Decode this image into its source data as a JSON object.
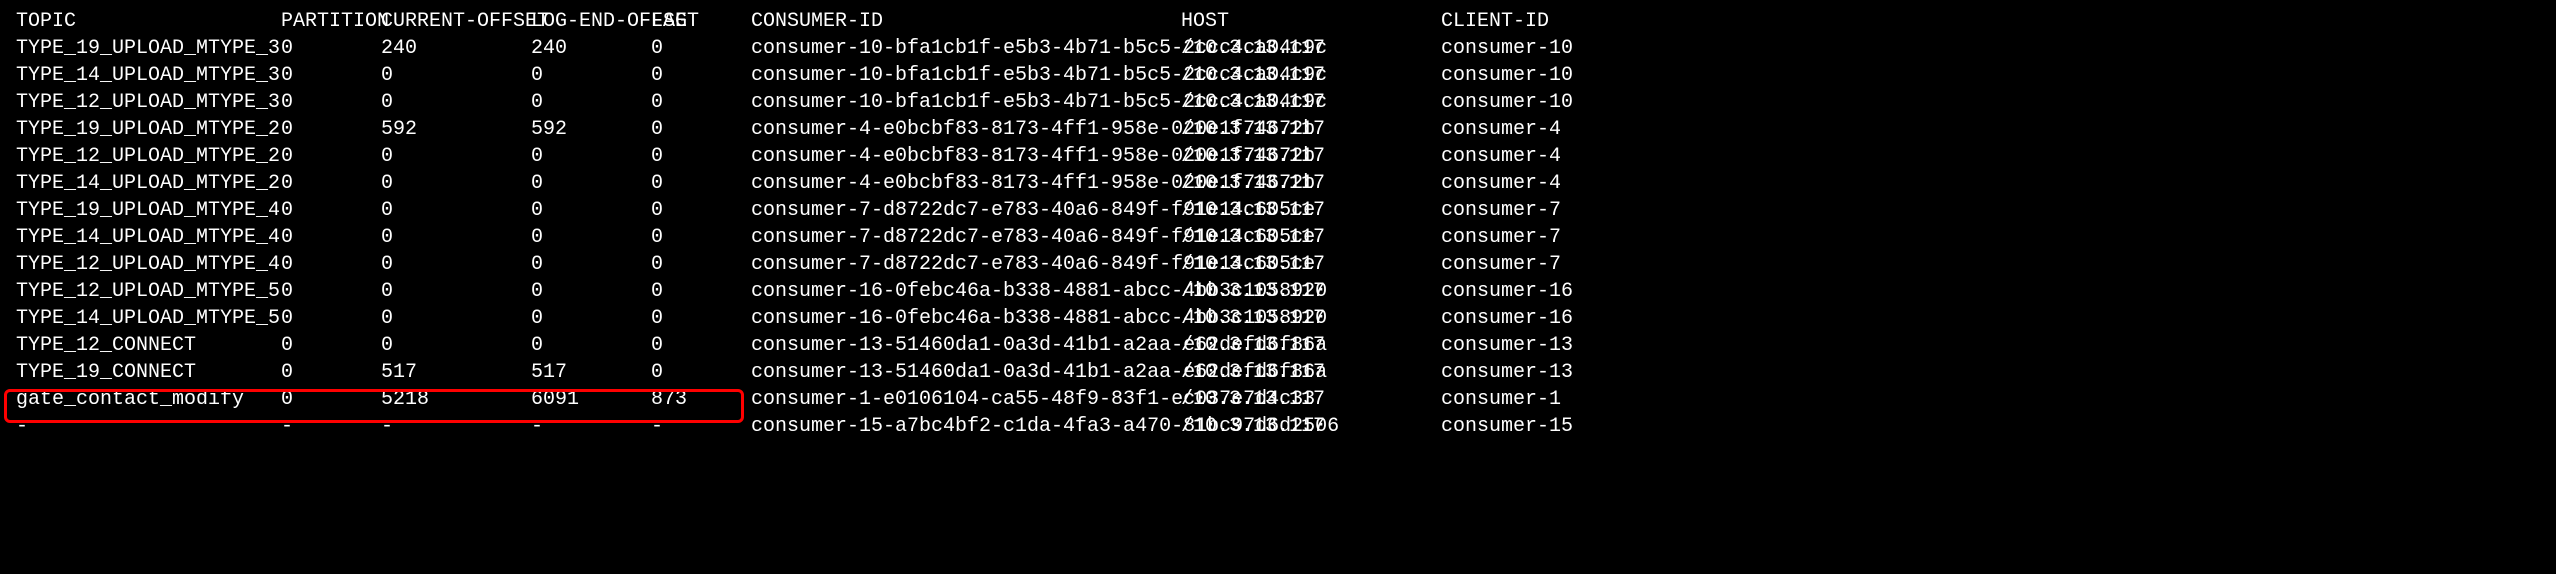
{
  "headers": {
    "topic": "TOPIC",
    "partition": "PARTITION",
    "currentOffset": "CURRENT-OFFSET",
    "logEndOffset": "LOG-END-OFFSET",
    "lag": "LAG",
    "consumerId": "CONSUMER-ID",
    "host": "HOST",
    "clientId": "CLIENT-ID"
  },
  "rows": [
    {
      "topic": "TYPE_19_UPLOAD_MTYPE_3",
      "partition": "0",
      "currentOffset": "240",
      "logEndOffset": "240",
      "lag": "0",
      "consumerId": "consumer-10-bfa1cb1f-e5b3-4b71-b5c5-2ccc4ca04c9c",
      "host": "/10.3.13.117",
      "clientId": "consumer-10"
    },
    {
      "topic": "TYPE_14_UPLOAD_MTYPE_3",
      "partition": "0",
      "currentOffset": "0",
      "logEndOffset": "0",
      "lag": "0",
      "consumerId": "consumer-10-bfa1cb1f-e5b3-4b71-b5c5-2ccc4ca04c9c",
      "host": "/10.3.13.117",
      "clientId": "consumer-10"
    },
    {
      "topic": "TYPE_12_UPLOAD_MTYPE_3",
      "partition": "0",
      "currentOffset": "0",
      "logEndOffset": "0",
      "lag": "0",
      "consumerId": "consumer-10-bfa1cb1f-e5b3-4b71-b5c5-2ccc4ca04c9c",
      "host": "/10.3.13.117",
      "clientId": "consumer-10"
    },
    {
      "topic": "TYPE_19_UPLOAD_MTYPE_2",
      "partition": "0",
      "currentOffset": "592",
      "logEndOffset": "592",
      "lag": "0",
      "consumerId": "consumer-4-e0bcbf83-8173-4ff1-958e-020e1f74672b",
      "host": "/10.3.13.117",
      "clientId": "consumer-4"
    },
    {
      "topic": "TYPE_12_UPLOAD_MTYPE_2",
      "partition": "0",
      "currentOffset": "0",
      "logEndOffset": "0",
      "lag": "0",
      "consumerId": "consumer-4-e0bcbf83-8173-4ff1-958e-020e1f74672b",
      "host": "/10.3.13.117",
      "clientId": "consumer-4"
    },
    {
      "topic": "TYPE_14_UPLOAD_MTYPE_2",
      "partition": "0",
      "currentOffset": "0",
      "logEndOffset": "0",
      "lag": "0",
      "consumerId": "consumer-4-e0bcbf83-8173-4ff1-958e-020e1f74672b",
      "host": "/10.3.13.117",
      "clientId": "consumer-4"
    },
    {
      "topic": "TYPE_19_UPLOAD_MTYPE_4",
      "partition": "0",
      "currentOffset": "0",
      "logEndOffset": "0",
      "lag": "0",
      "consumerId": "consumer-7-d8722dc7-e783-40a6-849f-f91e14c605ce",
      "host": "/10.3.13.117",
      "clientId": "consumer-7"
    },
    {
      "topic": "TYPE_14_UPLOAD_MTYPE_4",
      "partition": "0",
      "currentOffset": "0",
      "logEndOffset": "0",
      "lag": "0",
      "consumerId": "consumer-7-d8722dc7-e783-40a6-849f-f91e14c605ce",
      "host": "/10.3.13.117",
      "clientId": "consumer-7"
    },
    {
      "topic": "TYPE_12_UPLOAD_MTYPE_4",
      "partition": "0",
      "currentOffset": "0",
      "logEndOffset": "0",
      "lag": "0",
      "consumerId": "consumer-7-d8722dc7-e783-40a6-849f-f91e14c605ce",
      "host": "/10.3.13.117",
      "clientId": "consumer-7"
    },
    {
      "topic": "TYPE_12_UPLOAD_MTYPE_5",
      "partition": "0",
      "currentOffset": "0",
      "logEndOffset": "0",
      "lag": "0",
      "consumerId": "consumer-16-0febc46a-b338-4881-abcc-4bb3c1058920",
      "host": "/10.3.13.117",
      "clientId": "consumer-16"
    },
    {
      "topic": "TYPE_14_UPLOAD_MTYPE_5",
      "partition": "0",
      "currentOffset": "0",
      "logEndOffset": "0",
      "lag": "0",
      "consumerId": "consumer-16-0febc46a-b338-4881-abcc-4bb3c1058920",
      "host": "/10.3.13.117",
      "clientId": "consumer-16"
    },
    {
      "topic": "TYPE_12_CONNECT",
      "partition": "0",
      "currentOffset": "0",
      "logEndOffset": "0",
      "lag": "0",
      "consumerId": "consumer-13-51460da1-0a3d-41b1-a2aa-e62defd6f86a",
      "host": "/10.3.13.117",
      "clientId": "consumer-13"
    },
    {
      "topic": "TYPE_19_CONNECT",
      "partition": "0",
      "currentOffset": "517",
      "logEndOffset": "517",
      "lag": "0",
      "consumerId": "consumer-13-51460da1-0a3d-41b1-a2aa-e62defd6f86a",
      "host": "/10.3.13.117",
      "clientId": "consumer-13"
    },
    {
      "topic": "gate_contact_modify",
      "partition": "0",
      "currentOffset": "5218",
      "logEndOffset": "6091",
      "lag": "873",
      "consumerId": "consumer-1-e0106104-ca55-48f9-83f1-ec037e7d4c33",
      "host": "/10.3.13.117",
      "clientId": "consumer-1"
    },
    {
      "topic": "-",
      "partition": "-",
      "currentOffset": "-",
      "logEndOffset": "-",
      "lag": "-",
      "consumerId": "consumer-15-a7bc4bf2-c1da-4fa3-a470-81bc97d6d2506",
      "host": "/10.3.13.117",
      "clientId": "consumer-15"
    }
  ]
}
